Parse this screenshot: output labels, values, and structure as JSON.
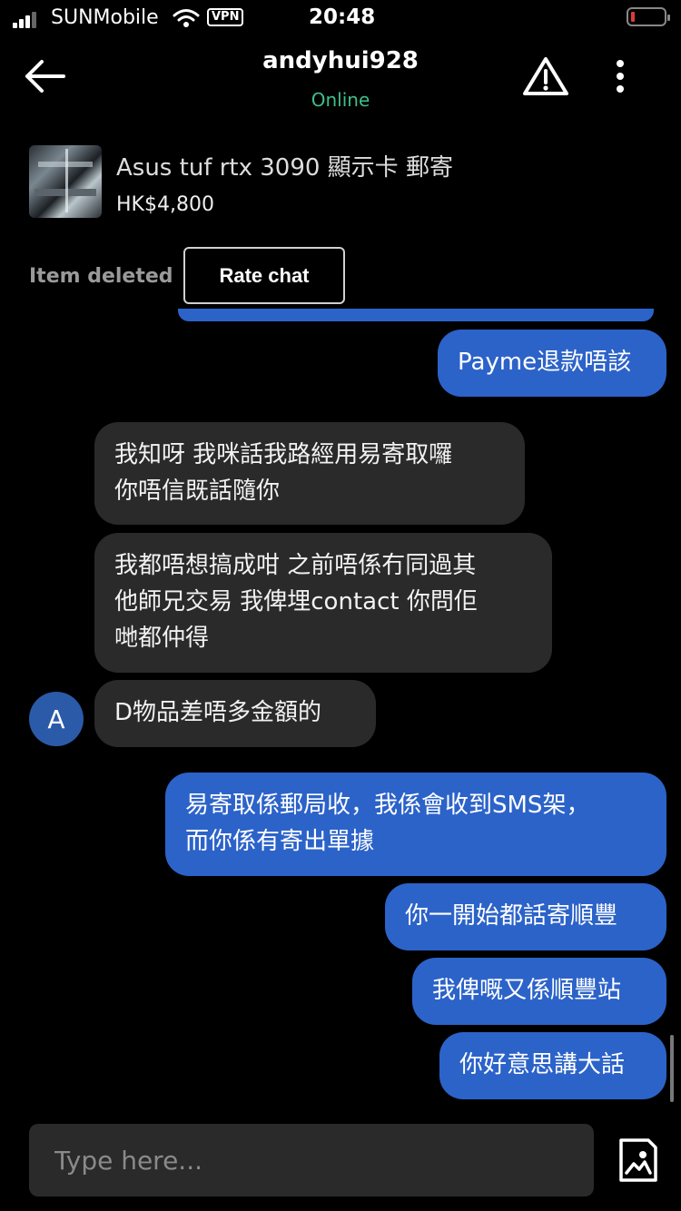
{
  "status": {
    "carrier": "SUNMobile",
    "vpn": "VPN",
    "time": "20:48"
  },
  "header": {
    "username": "andyhui928",
    "presence": "Online"
  },
  "listing": {
    "title": "Asus tuf rtx 3090 顯示卡 郵寄",
    "price": "HK$4,800",
    "status_text": "Item deleted",
    "rate_label": "Rate chat"
  },
  "messages": [
    {
      "from": "me",
      "text": "Payme退款唔該"
    },
    {
      "from": "them",
      "text": "我知呀 我咪話我路經用易寄取囉\n你唔信既話隨你"
    },
    {
      "from": "them",
      "text": "我都唔想搞成咁 之前唔係冇同過其\n他師兄交易 我俾埋contact 你問佢\n哋都仲得"
    },
    {
      "from": "them",
      "text": "D物品差唔多金額的"
    },
    {
      "from": "me",
      "text": "易寄取係郵局收，我係會收到SMS架，\n而你係有寄出單據"
    },
    {
      "from": "me",
      "text": "你一開始都話寄順豐"
    },
    {
      "from": "me",
      "text": "我俾嘅又係順豐站"
    },
    {
      "from": "me",
      "text": "你好意思講大話"
    }
  ],
  "avatar_initial": "A",
  "composer": {
    "placeholder": "Type here..."
  },
  "colors": {
    "outgoing_bubble": "#2c63c9",
    "incoming_bubble": "#2a2a2a",
    "online": "#3fbf8a"
  }
}
